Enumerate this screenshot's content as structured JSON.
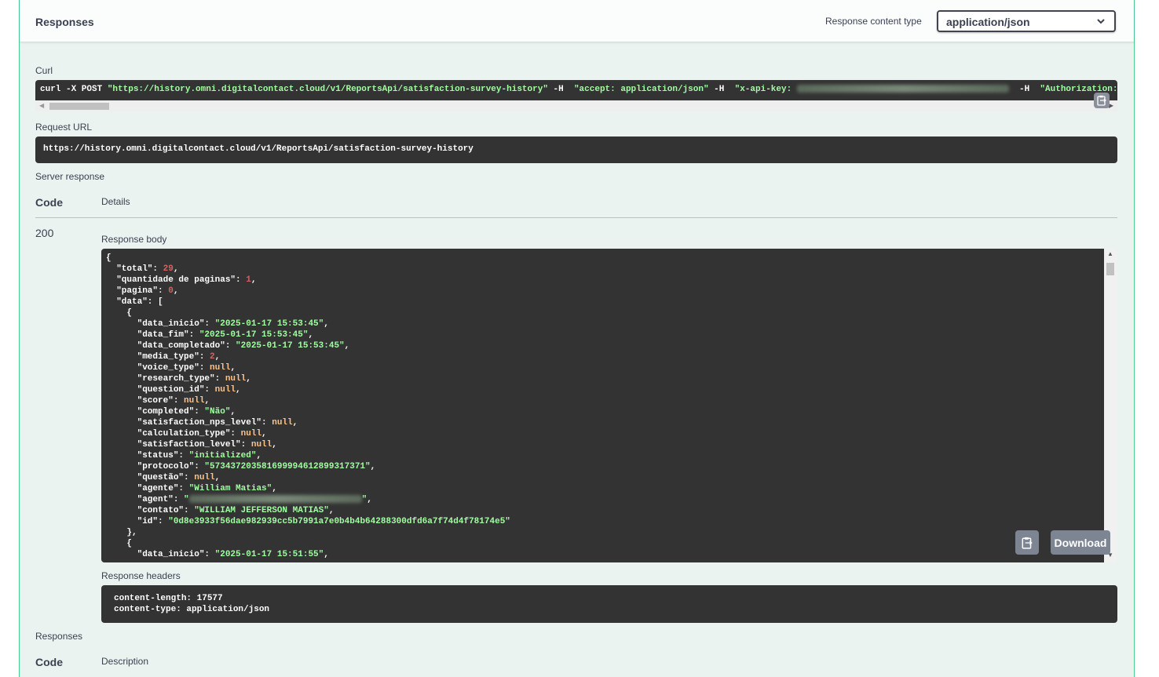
{
  "responses_section": {
    "title": "Responses",
    "content_type_label": "Response content type",
    "content_type_value": "application/json"
  },
  "curl": {
    "label": "Curl",
    "cmd_prefix": "curl -X POST ",
    "url_quoted": "\"https://history.omni.digitalcontact.cloud/v1/ReportsApi/satisfaction-survey-history\"",
    "h1_flag": " -H  ",
    "accept_header": "\"accept: application/json\"",
    "h2_flag": " -H  ",
    "api_key_header": "\"x-api-key: ",
    "h3_flag": "  -H  ",
    "auth_header": "\"Authorization:"
  },
  "request_url": {
    "label": "Request URL",
    "value": "https://history.omni.digitalcontact.cloud/v1/ReportsApi/satisfaction-survey-history"
  },
  "server_response": {
    "label": "Server response",
    "code_header": "Code",
    "details_header": "Details",
    "code": "200",
    "body_label": "Response body",
    "download_label": "Download",
    "headers_label": "Response headers",
    "headers": [
      "content-length: 17577",
      "content-type: application/json"
    ]
  },
  "response_body": {
    "total": "29",
    "quantidade_de_paginas": "1",
    "pagina": "0",
    "item1": {
      "data_inicio": "\"2025-01-17 15:53:45\"",
      "data_fim": "\"2025-01-17 15:53:45\"",
      "data_completado": "\"2025-01-17 15:53:45\"",
      "media_type": "2",
      "voice_type": "null",
      "research_type": "null",
      "question_id": "null",
      "score": "null",
      "completed": "\"Não\"",
      "satisfaction_nps_level": "null",
      "calculation_type": "null",
      "satisfaction_level": "null",
      "status": "\"initialized\"",
      "protocolo": "\"5734372035816999946128993173​71\"",
      "questao": "null",
      "agente": "\"William Matias\"",
      "agent_open": "\"",
      "agent_close": "\"",
      "contato": "\"WILLIAM JEFFERSON MATIAS\"",
      "id": "\"0d8e3933f56dae982939cc5b7991a7e0b4b4b64288300dfd6a7f74d4f78174e5\""
    },
    "item2": {
      "data_inicio": "\"2025-01-17 15:51:55\""
    }
  },
  "responses_footer": {
    "title": "Responses",
    "code_header": "Code",
    "description_header": "Description"
  }
}
